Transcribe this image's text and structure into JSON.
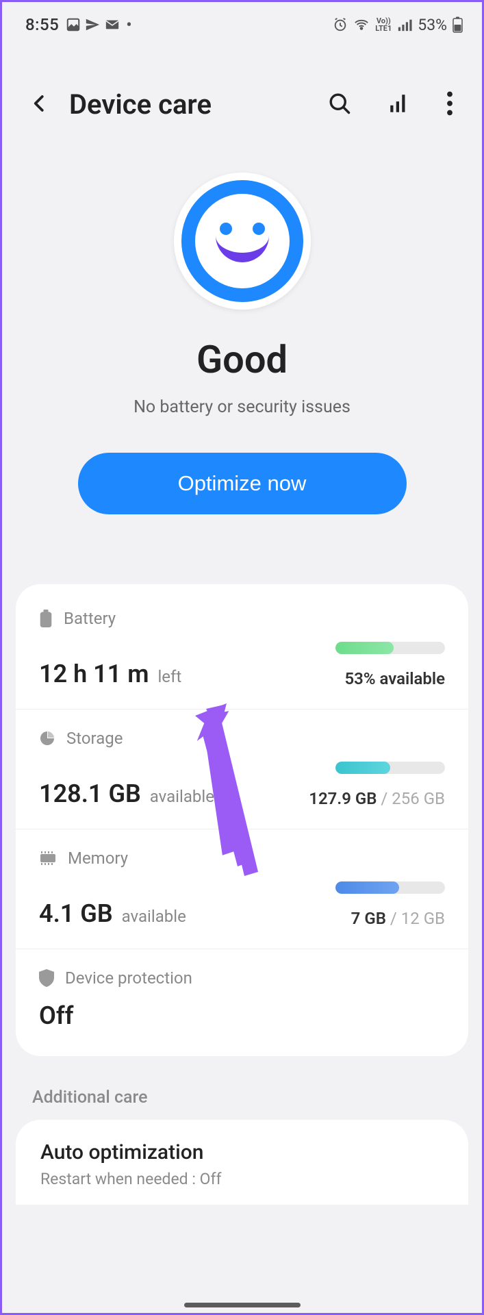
{
  "status": {
    "time": "8:55",
    "battery_pct": "53%"
  },
  "header": {
    "title": "Device care"
  },
  "hero": {
    "status": "Good",
    "subtitle": "No battery or security issues",
    "button": "Optimize now"
  },
  "battery": {
    "label": "Battery",
    "value": "12 h 11 m",
    "suffix": "left",
    "side": "53% available",
    "fill_pct": 53
  },
  "storage": {
    "label": "Storage",
    "value": "128.1 GB",
    "suffix": "available",
    "used": "127.9 GB",
    "total": "256 GB",
    "fill_pct": 50
  },
  "memory": {
    "label": "Memory",
    "value": "4.1 GB",
    "suffix": "available",
    "used": "7 GB",
    "total": "12 GB",
    "fill_pct": 58
  },
  "protection": {
    "label": "Device protection",
    "value": "Off"
  },
  "additional": {
    "section": "Additional care",
    "title": "Auto optimization",
    "subtitle": "Restart when needed : Off"
  }
}
